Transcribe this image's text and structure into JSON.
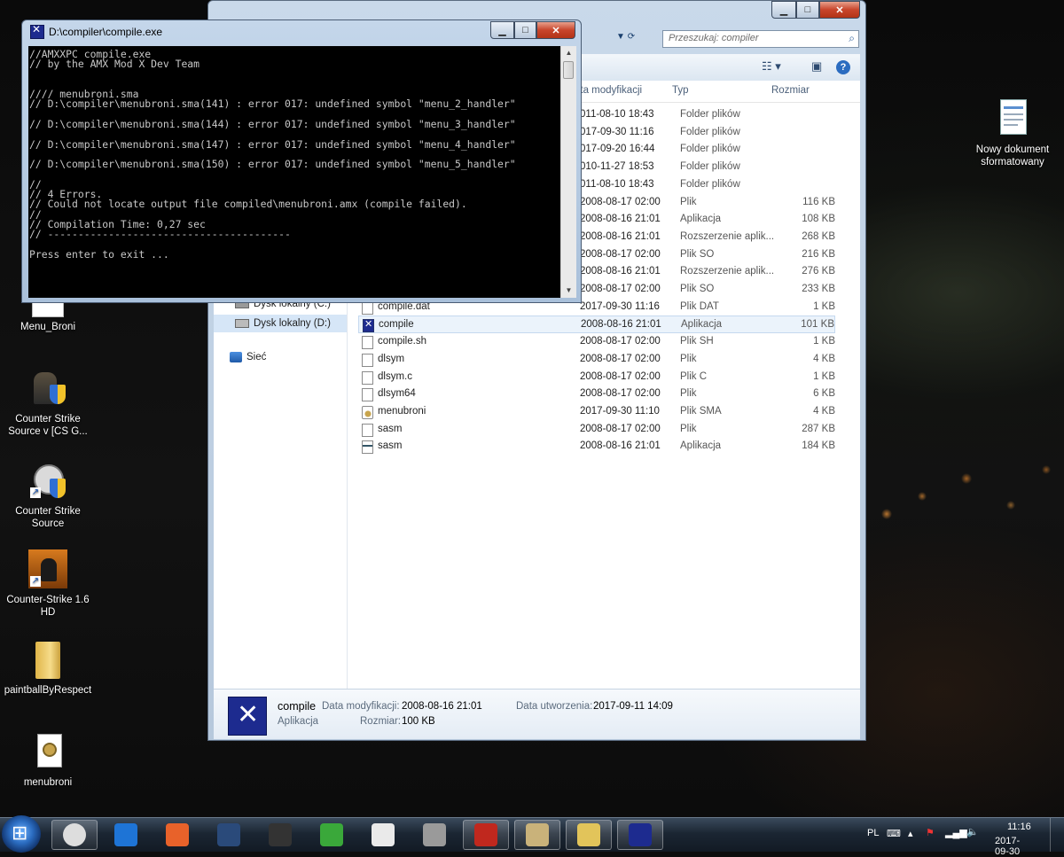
{
  "desktop": {
    "icons_left": [
      {
        "label": "Menu_Broni"
      },
      {
        "label": "Counter Strike Source v [CS G..."
      },
      {
        "label": "Counter Strike Source"
      },
      {
        "label": "Counter-Strike 1.6 HD"
      },
      {
        "label": "paintballByRespect"
      },
      {
        "label": "menubroni"
      }
    ],
    "icons_right": [
      {
        "label": "Nowy dokument sformatowany"
      }
    ]
  },
  "explorer": {
    "search_placeholder": "Przeszukaj: compiler",
    "columns": {
      "date": "ata modyfikacji",
      "type": "Typ",
      "size": "Rozmiar"
    },
    "nav": {
      "disk_c": "Dysk lokalny (C:)",
      "disk_d": "Dysk lokalny (D:)",
      "network": "Sieć"
    },
    "files": [
      {
        "name": "",
        "date": "011-08-10 18:43",
        "type": "Folder plików",
        "size": "",
        "icon": "folder"
      },
      {
        "name": "",
        "date": "017-09-30 11:16",
        "type": "Folder plików",
        "size": "",
        "icon": "folder"
      },
      {
        "name": "",
        "date": "017-09-20 16:44",
        "type": "Folder plików",
        "size": "",
        "icon": "folder"
      },
      {
        "name": "",
        "date": "010-11-27 18:53",
        "type": "Folder plików",
        "size": "",
        "icon": "folder"
      },
      {
        "name": "",
        "date": "011-08-10 18:43",
        "type": "Folder plików",
        "size": "",
        "icon": "folder"
      },
      {
        "name": "",
        "date": "2008-08-17 02:00",
        "type": "Plik",
        "size": "116 KB",
        "icon": "file"
      },
      {
        "name": "",
        "date": "2008-08-16 21:01",
        "type": "Aplikacja",
        "size": "108 KB",
        "icon": "file"
      },
      {
        "name": "",
        "date": "2008-08-16 21:01",
        "type": "Rozszerzenie aplik...",
        "size": "268 KB",
        "icon": "file"
      },
      {
        "name": "",
        "date": "2008-08-17 02:00",
        "type": "Plik SO",
        "size": "216 KB",
        "icon": "file"
      },
      {
        "name": "",
        "date": "2008-08-16 21:01",
        "type": "Rozszerzenie aplik...",
        "size": "276 KB",
        "icon": "file"
      },
      {
        "name": "",
        "date": "2008-08-17 02:00",
        "type": "Plik SO",
        "size": "233 KB",
        "icon": "file"
      },
      {
        "name": "compile.dat",
        "date": "2017-09-30 11:16",
        "type": "Plik DAT",
        "size": "1 KB",
        "icon": "file"
      },
      {
        "name": "compile",
        "date": "2008-08-16 21:01",
        "type": "Aplikacja",
        "size": "101 KB",
        "icon": "app"
      },
      {
        "name": "compile.sh",
        "date": "2008-08-17 02:00",
        "type": "Plik SH",
        "size": "1 KB",
        "icon": "file"
      },
      {
        "name": "dlsym",
        "date": "2008-08-17 02:00",
        "type": "Plik",
        "size": "4 KB",
        "icon": "file"
      },
      {
        "name": "dlsym.c",
        "date": "2008-08-17 02:00",
        "type": "Plik C",
        "size": "1 KB",
        "icon": "file"
      },
      {
        "name": "dlsym64",
        "date": "2008-08-17 02:00",
        "type": "Plik",
        "size": "6 KB",
        "icon": "file"
      },
      {
        "name": "menubroni",
        "date": "2017-09-30 11:10",
        "type": "Plik SMA",
        "size": "4 KB",
        "icon": "sma"
      },
      {
        "name": "sasm",
        "date": "2008-08-17 02:00",
        "type": "Plik",
        "size": "287 KB",
        "icon": "file"
      },
      {
        "name": "sasm",
        "date": "2008-08-16 21:01",
        "type": "Aplikacja",
        "size": "184 KB",
        "icon": "sasm"
      }
    ],
    "details": {
      "name": "compile",
      "kind": "Aplikacja",
      "modified_label": "Data modyfikacji:",
      "modified_value": "2008-08-16 21:01",
      "size_label": "Rozmiar:",
      "size_value": "100 KB",
      "created_label": "Data utworzenia:",
      "created_value": "2017-09-11 14:09"
    }
  },
  "console": {
    "title": "D:\\compiler\\compile.exe",
    "output": "//AMXXPC compile.exe\n// by the AMX Mod X Dev Team\n\n\n//// menubroni.sma\n// D:\\compiler\\menubroni.sma(141) : error 017: undefined symbol \"menu_2_handler\"\n\n// D:\\compiler\\menubroni.sma(144) : error 017: undefined symbol \"menu_3_handler\"\n\n// D:\\compiler\\menubroni.sma(147) : error 017: undefined symbol \"menu_4_handler\"\n\n// D:\\compiler\\menubroni.sma(150) : error 017: undefined symbol \"menu_5_handler\"\n\n//\n// 4 Errors.\n// Could not locate output file compiled\\menubroni.amx (compile failed).\n//\n// Compilation Time: 0,27 sec\n// ----------------------------------------\n\nPress enter to exit ..."
  },
  "taskbar": {
    "apps": [
      "chrome-icon",
      "maxthon-icon",
      "firefox-icon",
      "steam-icon",
      "csgo-icon",
      "nvidia-icon",
      "notepad-icon",
      "cs-source-icon",
      "filezilla-icon",
      "kb2-icon",
      "explorer-icon",
      "compile-icon"
    ],
    "lang": "PL",
    "time": "11:16",
    "date": "2017-09-30"
  },
  "colors": {
    "accent": "#1d2b8f",
    "close_red": "#c8452b",
    "console_bg": "#000000"
  }
}
